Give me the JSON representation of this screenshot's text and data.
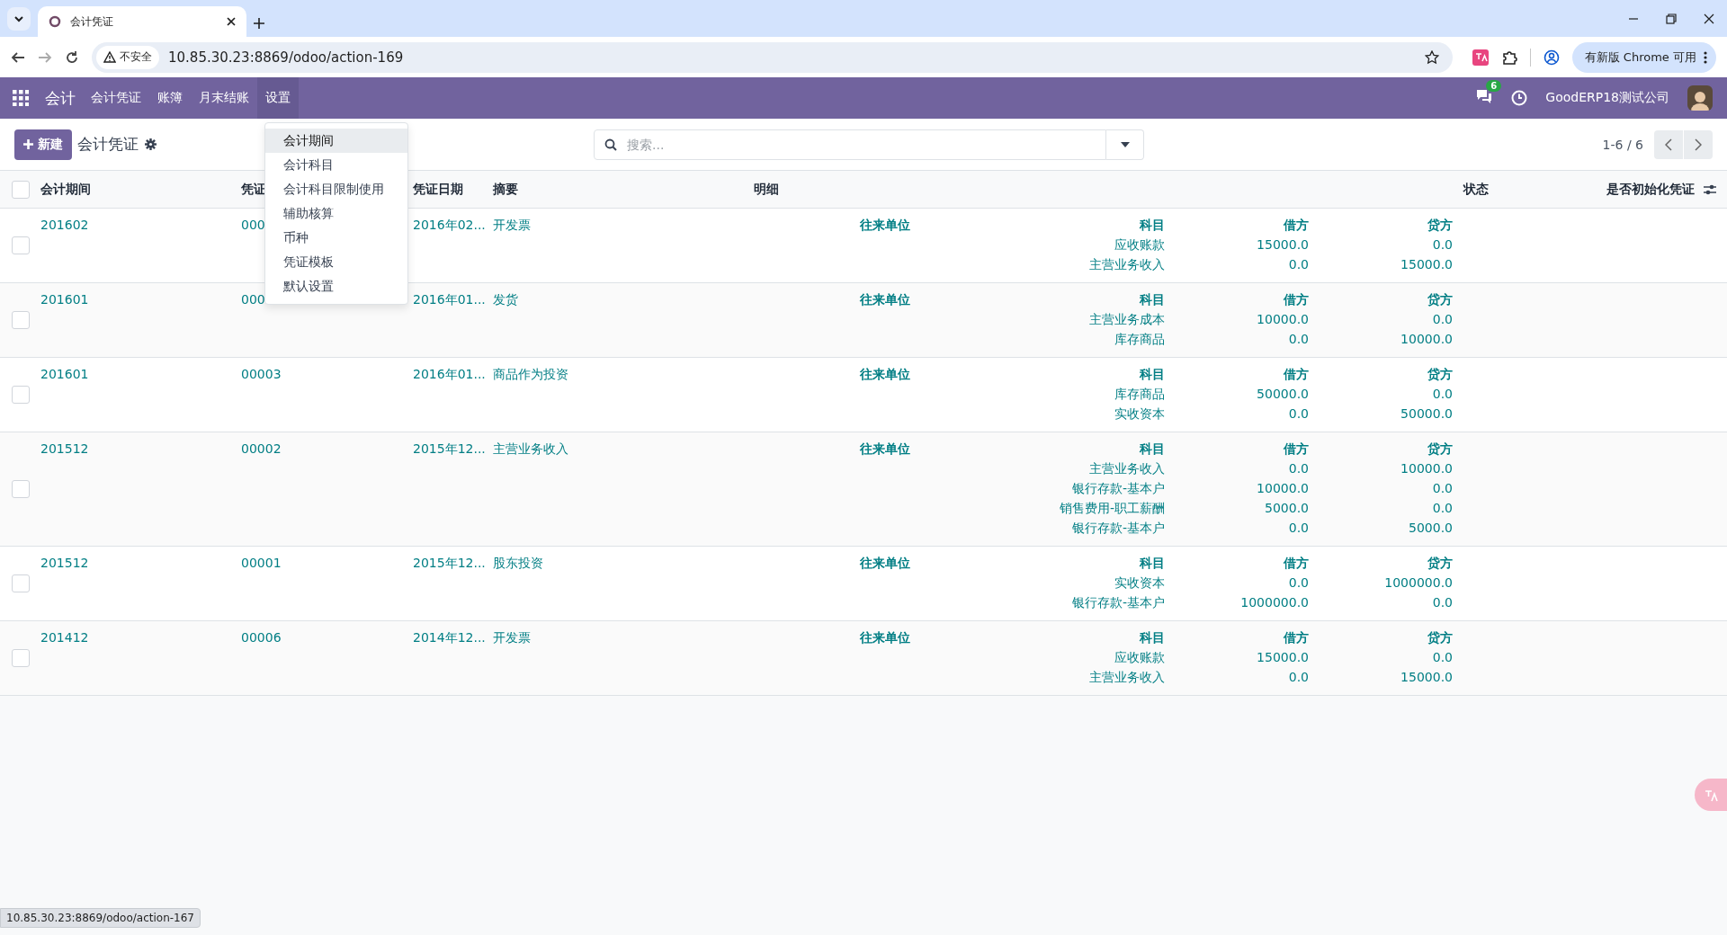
{
  "browser": {
    "tab_title": "会计凭证",
    "security": "不安全",
    "url": "10.85.30.23:8869/odoo/action-169",
    "update_button": "有新版 Chrome 可用",
    "status_url": "10.85.30.23:8869/odoo/action-167"
  },
  "navbar": {
    "app": "会计",
    "menus": [
      {
        "label": "会计凭证",
        "expanded": false
      },
      {
        "label": "账簿",
        "expanded": false
      },
      {
        "label": "月末结账",
        "expanded": false
      },
      {
        "label": "设置",
        "expanded": true,
        "items": [
          {
            "label": "会计期间",
            "selected": true
          },
          {
            "label": "会计科目",
            "selected": false
          },
          {
            "label": "会计科目限制使用",
            "selected": false
          },
          {
            "label": "辅助核算",
            "selected": false
          },
          {
            "label": "币种",
            "selected": false
          },
          {
            "label": "凭证模板",
            "selected": false
          },
          {
            "label": "默认设置",
            "selected": false
          }
        ]
      }
    ],
    "message_count": "6",
    "company": "GoodERP18测试公司"
  },
  "control_panel": {
    "new_button": "新建",
    "title": "会计凭证",
    "search": {
      "placeholder": "搜索..."
    },
    "pager": "1-6 / 6"
  },
  "table": {
    "select_all": {
      "checked": false
    },
    "columns": [
      "会计期间",
      "凭证",
      "凭证日期",
      "摘要",
      "明细",
      "状态",
      "是否初始化凭证"
    ],
    "rows": [
      {
        "checked": false,
        "period": "201602",
        "number": "000",
        "date": "2016年02...",
        "summary": "开发票",
        "detail_header": [
          "往来单位",
          "科目",
          "借方",
          "贷方"
        ],
        "lines": [
          {
            "account": "应收账款",
            "debit": "15000.0",
            "credit": "0.0"
          },
          {
            "account": "主营业务收入",
            "debit": "0.0",
            "credit": "15000.0"
          }
        ]
      },
      {
        "checked": false,
        "period": "201601",
        "number": "000",
        "date": "2016年01...",
        "summary": "发货",
        "detail_header": [
          "往来单位",
          "科目",
          "借方",
          "贷方"
        ],
        "lines": [
          {
            "account": "主营业务成本",
            "debit": "10000.0",
            "credit": "0.0"
          },
          {
            "account": "库存商品",
            "debit": "0.0",
            "credit": "10000.0"
          }
        ]
      },
      {
        "checked": false,
        "period": "201601",
        "number": "00003",
        "date": "2016年01...",
        "summary": "商品作为投资",
        "detail_header": [
          "往来单位",
          "科目",
          "借方",
          "贷方"
        ],
        "lines": [
          {
            "account": "库存商品",
            "debit": "50000.0",
            "credit": "0.0"
          },
          {
            "account": "实收资本",
            "debit": "0.0",
            "credit": "50000.0"
          }
        ]
      },
      {
        "checked": false,
        "period": "201512",
        "number": "00002",
        "date": "2015年12...",
        "summary": "主营业务收入",
        "detail_header": [
          "往来单位",
          "科目",
          "借方",
          "贷方"
        ],
        "lines": [
          {
            "account": "主营业务收入",
            "debit": "0.0",
            "credit": "10000.0"
          },
          {
            "account": "银行存款-基本户",
            "debit": "10000.0",
            "credit": "0.0"
          },
          {
            "account": "销售费用-职工薪酬",
            "debit": "5000.0",
            "credit": "0.0"
          },
          {
            "account": "银行存款-基本户",
            "debit": "0.0",
            "credit": "5000.0"
          }
        ]
      },
      {
        "checked": false,
        "period": "201512",
        "number": "00001",
        "date": "2015年12...",
        "summary": "股东投资",
        "detail_header": [
          "往来单位",
          "科目",
          "借方",
          "贷方"
        ],
        "lines": [
          {
            "account": "实收资本",
            "debit": "0.0",
            "credit": "1000000.0"
          },
          {
            "account": "银行存款-基本户",
            "debit": "1000000.0",
            "credit": "0.0"
          }
        ]
      },
      {
        "checked": false,
        "period": "201412",
        "number": "00006",
        "date": "2014年12...",
        "summary": "开发票",
        "detail_header": [
          "往来单位",
          "科目",
          "借方",
          "贷方"
        ],
        "lines": [
          {
            "account": "应收账款",
            "debit": "15000.0",
            "credit": "0.0"
          },
          {
            "account": "主营业务收入",
            "debit": "0.0",
            "credit": "15000.0"
          }
        ]
      }
    ]
  }
}
